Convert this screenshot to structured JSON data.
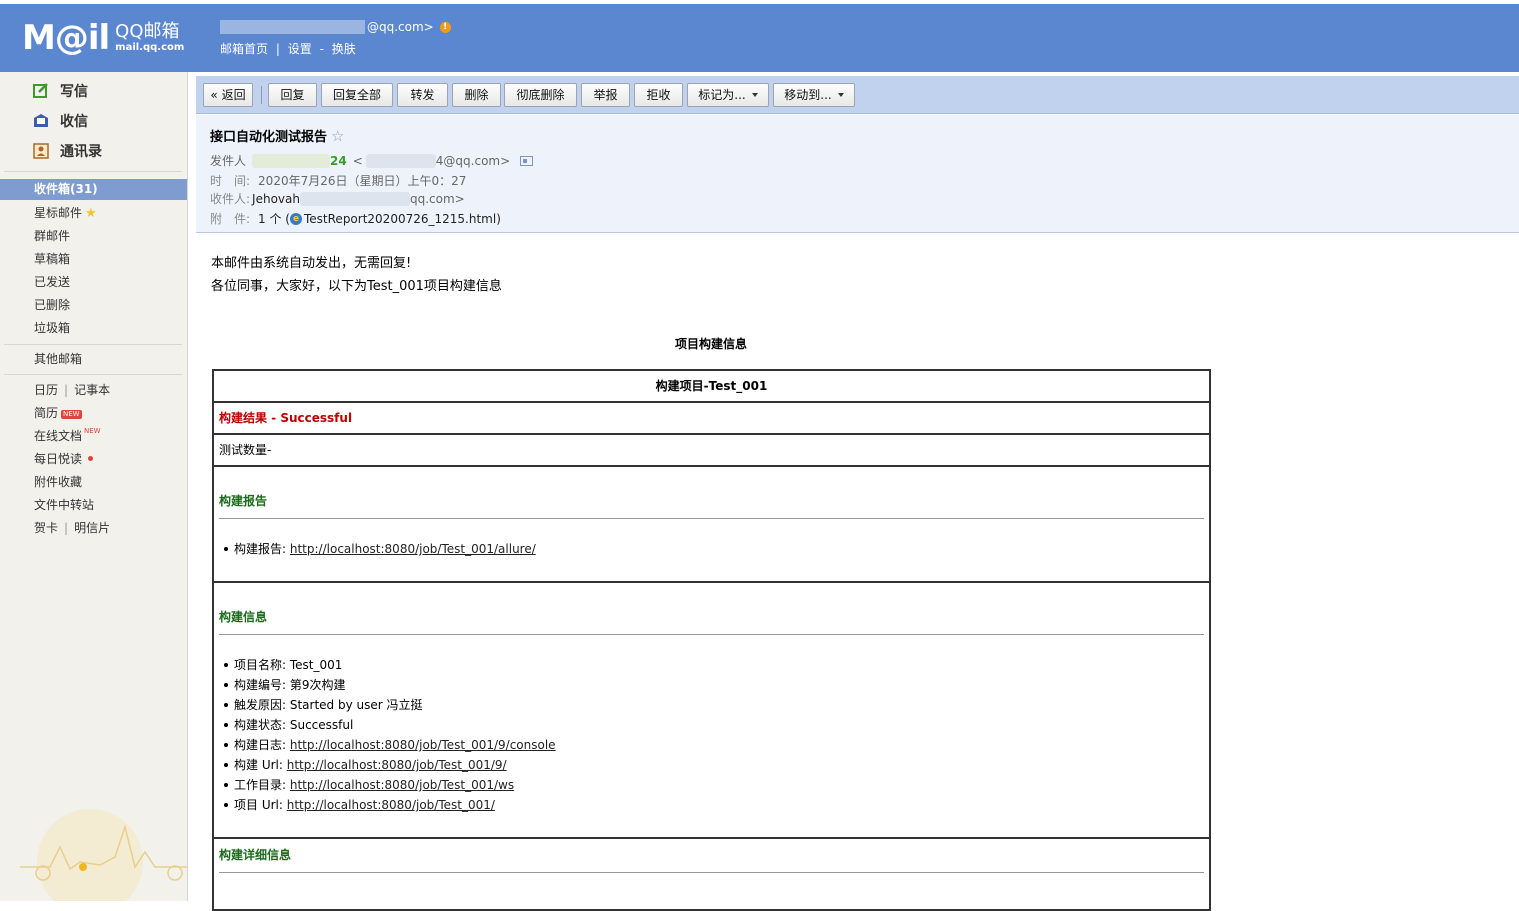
{
  "header": {
    "logo_text": "M@il",
    "logo_brand": "QQ邮箱",
    "logo_domain": "mail.qq.com",
    "account_suffix": "@qq.com>",
    "links": [
      "邮箱首页",
      "设置",
      "换肤"
    ],
    "link_separators": [
      "|",
      "-"
    ]
  },
  "sidebar": {
    "actions": [
      {
        "label": "写信",
        "icon": "compose-icon"
      },
      {
        "label": "收信",
        "icon": "inbox-receive-icon"
      },
      {
        "label": "通讯录",
        "icon": "contacts-icon"
      }
    ],
    "inbox": "收件箱(31)",
    "folders": [
      "星标邮件",
      "群邮件",
      "草稿箱",
      "已发送",
      "已删除",
      "垃圾箱"
    ],
    "other_mailbox": "其他邮箱",
    "calendar": "日历",
    "notebook": "记事本",
    "resume": "简历",
    "docs": "在线文档",
    "daily": "每日悦读",
    "attachments": "附件收藏",
    "transfer": "文件中转站",
    "card": "贺卡",
    "postcard": "明信片",
    "new_badge": "NEW",
    "separator": "|"
  },
  "toolbar": {
    "back": "« 返回",
    "buttons": [
      "回复",
      "回复全部",
      "转发",
      "删除",
      "彻底删除",
      "举报",
      "拒收"
    ],
    "mark_as": "标记为...",
    "move_to": "移动到..."
  },
  "mail": {
    "subject": "接口自动化测试报告",
    "from_label": "发件人",
    "from_partial": "24",
    "from_addr_partial": "4@qq.com>",
    "from_open": "<",
    "time_label": "时　间:",
    "time_value": "2020年7月26日（星期日）上午0：27",
    "to_label": "收件人:",
    "to_name": "Jehovah",
    "to_addr_partial": "qq.com>",
    "attach_label": "附　件:",
    "attach_count": "1 个 (",
    "attach_file": "TestReport20200726_1215.html",
    "attach_close": ")"
  },
  "body": {
    "line1": "本邮件由系统自动发出，无需回复!",
    "line2": "各位同事，大家好，以下为Test_001项目构建信息",
    "report_title": "项目构建信息",
    "project_header": "构建项目-Test_001",
    "result_label": "构建结果 - ",
    "result_value": "Successful",
    "test_count": "测试数量-",
    "report_section": "构建报告",
    "report_item_label": "构建报告:",
    "report_item_link": "http://localhost:8080/job/Test_001/allure/",
    "info_section": "构建信息",
    "info_items": [
      {
        "label": "项目名称: ",
        "value": "Test_001",
        "link": false
      },
      {
        "label": "构建编号: ",
        "value": "第9次构建",
        "link": false
      },
      {
        "label": "触发原因: ",
        "value": "Started by user 冯立挺",
        "link": false
      },
      {
        "label": "构建状态: ",
        "value": "Successful",
        "link": false
      },
      {
        "label": "构建日志: ",
        "value": "http://localhost:8080/job/Test_001/9/console",
        "link": true
      },
      {
        "label": "构建 Url: ",
        "value": "http://localhost:8080/job/Test_001/9/",
        "link": true
      },
      {
        "label": "工作目录: ",
        "value": "http://localhost:8080/job/Test_001/ws",
        "link": true
      },
      {
        "label": "项目 Url: ",
        "value": "http://localhost:8080/job/Test_001/",
        "link": true
      }
    ],
    "detail_section": "构建详细信息"
  },
  "colors": {
    "header_bg": "#5b87d0",
    "toolbar_bg": "#c0d2ee",
    "sidebar_bg": "#f2f1ec",
    "inbox_highlight": "#7f9cd1",
    "result_red": "#c00000",
    "section_green": "#1a6b1a"
  }
}
